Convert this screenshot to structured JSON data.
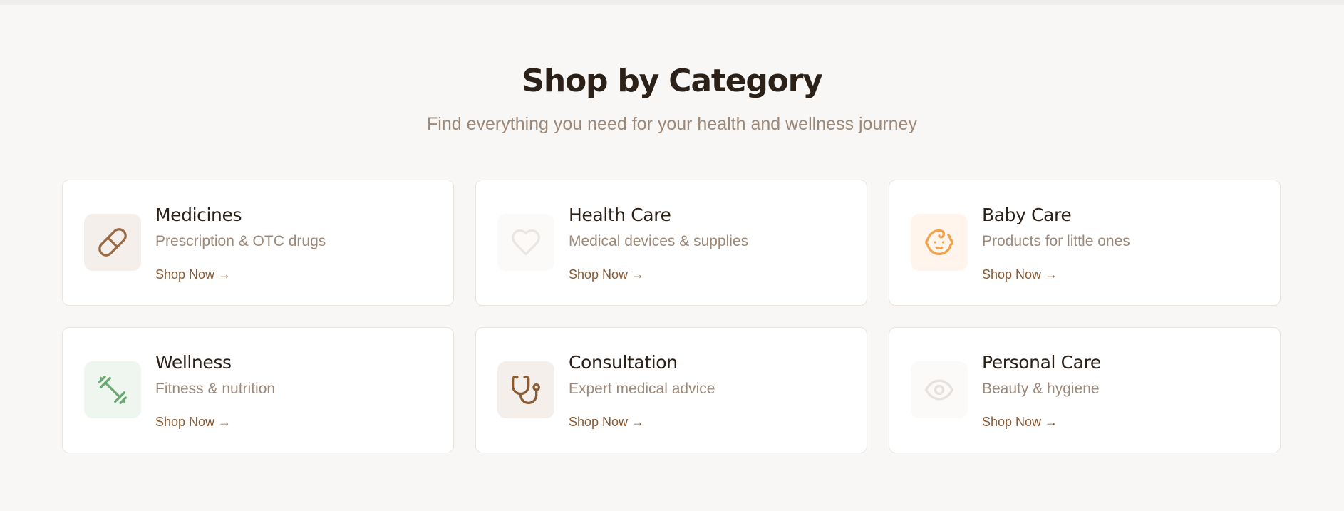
{
  "section": {
    "title": "Shop by Category",
    "subtitle": "Find everything you need for your health and wellness journey"
  },
  "categories": [
    {
      "title": "Medicines",
      "description": "Prescription & OTC drugs",
      "link": "Shop Now →",
      "icon": "pill-icon",
      "icon_color": "#9a6a45",
      "icon_bg": "#f4efea"
    },
    {
      "title": "Health Care",
      "description": "Medical devices & supplies",
      "link": "Shop Now →",
      "icon": "heart-icon",
      "icon_color": "#ebe6e1",
      "icon_bg": "#fbfaf9"
    },
    {
      "title": "Baby Care",
      "description": "Products for little ones",
      "link": "Shop Now →",
      "icon": "baby-icon",
      "icon_color": "#f2a34a",
      "icon_bg": "#fff5ec"
    },
    {
      "title": "Wellness",
      "description": "Fitness & nutrition",
      "link": "Shop Now →",
      "icon": "dumbbell-icon",
      "icon_color": "#6aaa72",
      "icon_bg": "#eef6ef"
    },
    {
      "title": "Consultation",
      "description": "Expert medical advice",
      "link": "Shop Now →",
      "icon": "stethoscope-icon",
      "icon_color": "#8a5a32",
      "icon_bg": "#f4efea"
    },
    {
      "title": "Personal Care",
      "description": "Beauty & hygiene",
      "link": "Shop Now →",
      "icon": "eye-icon",
      "icon_color": "#e6e1dc",
      "icon_bg": "#fbfaf9"
    }
  ]
}
